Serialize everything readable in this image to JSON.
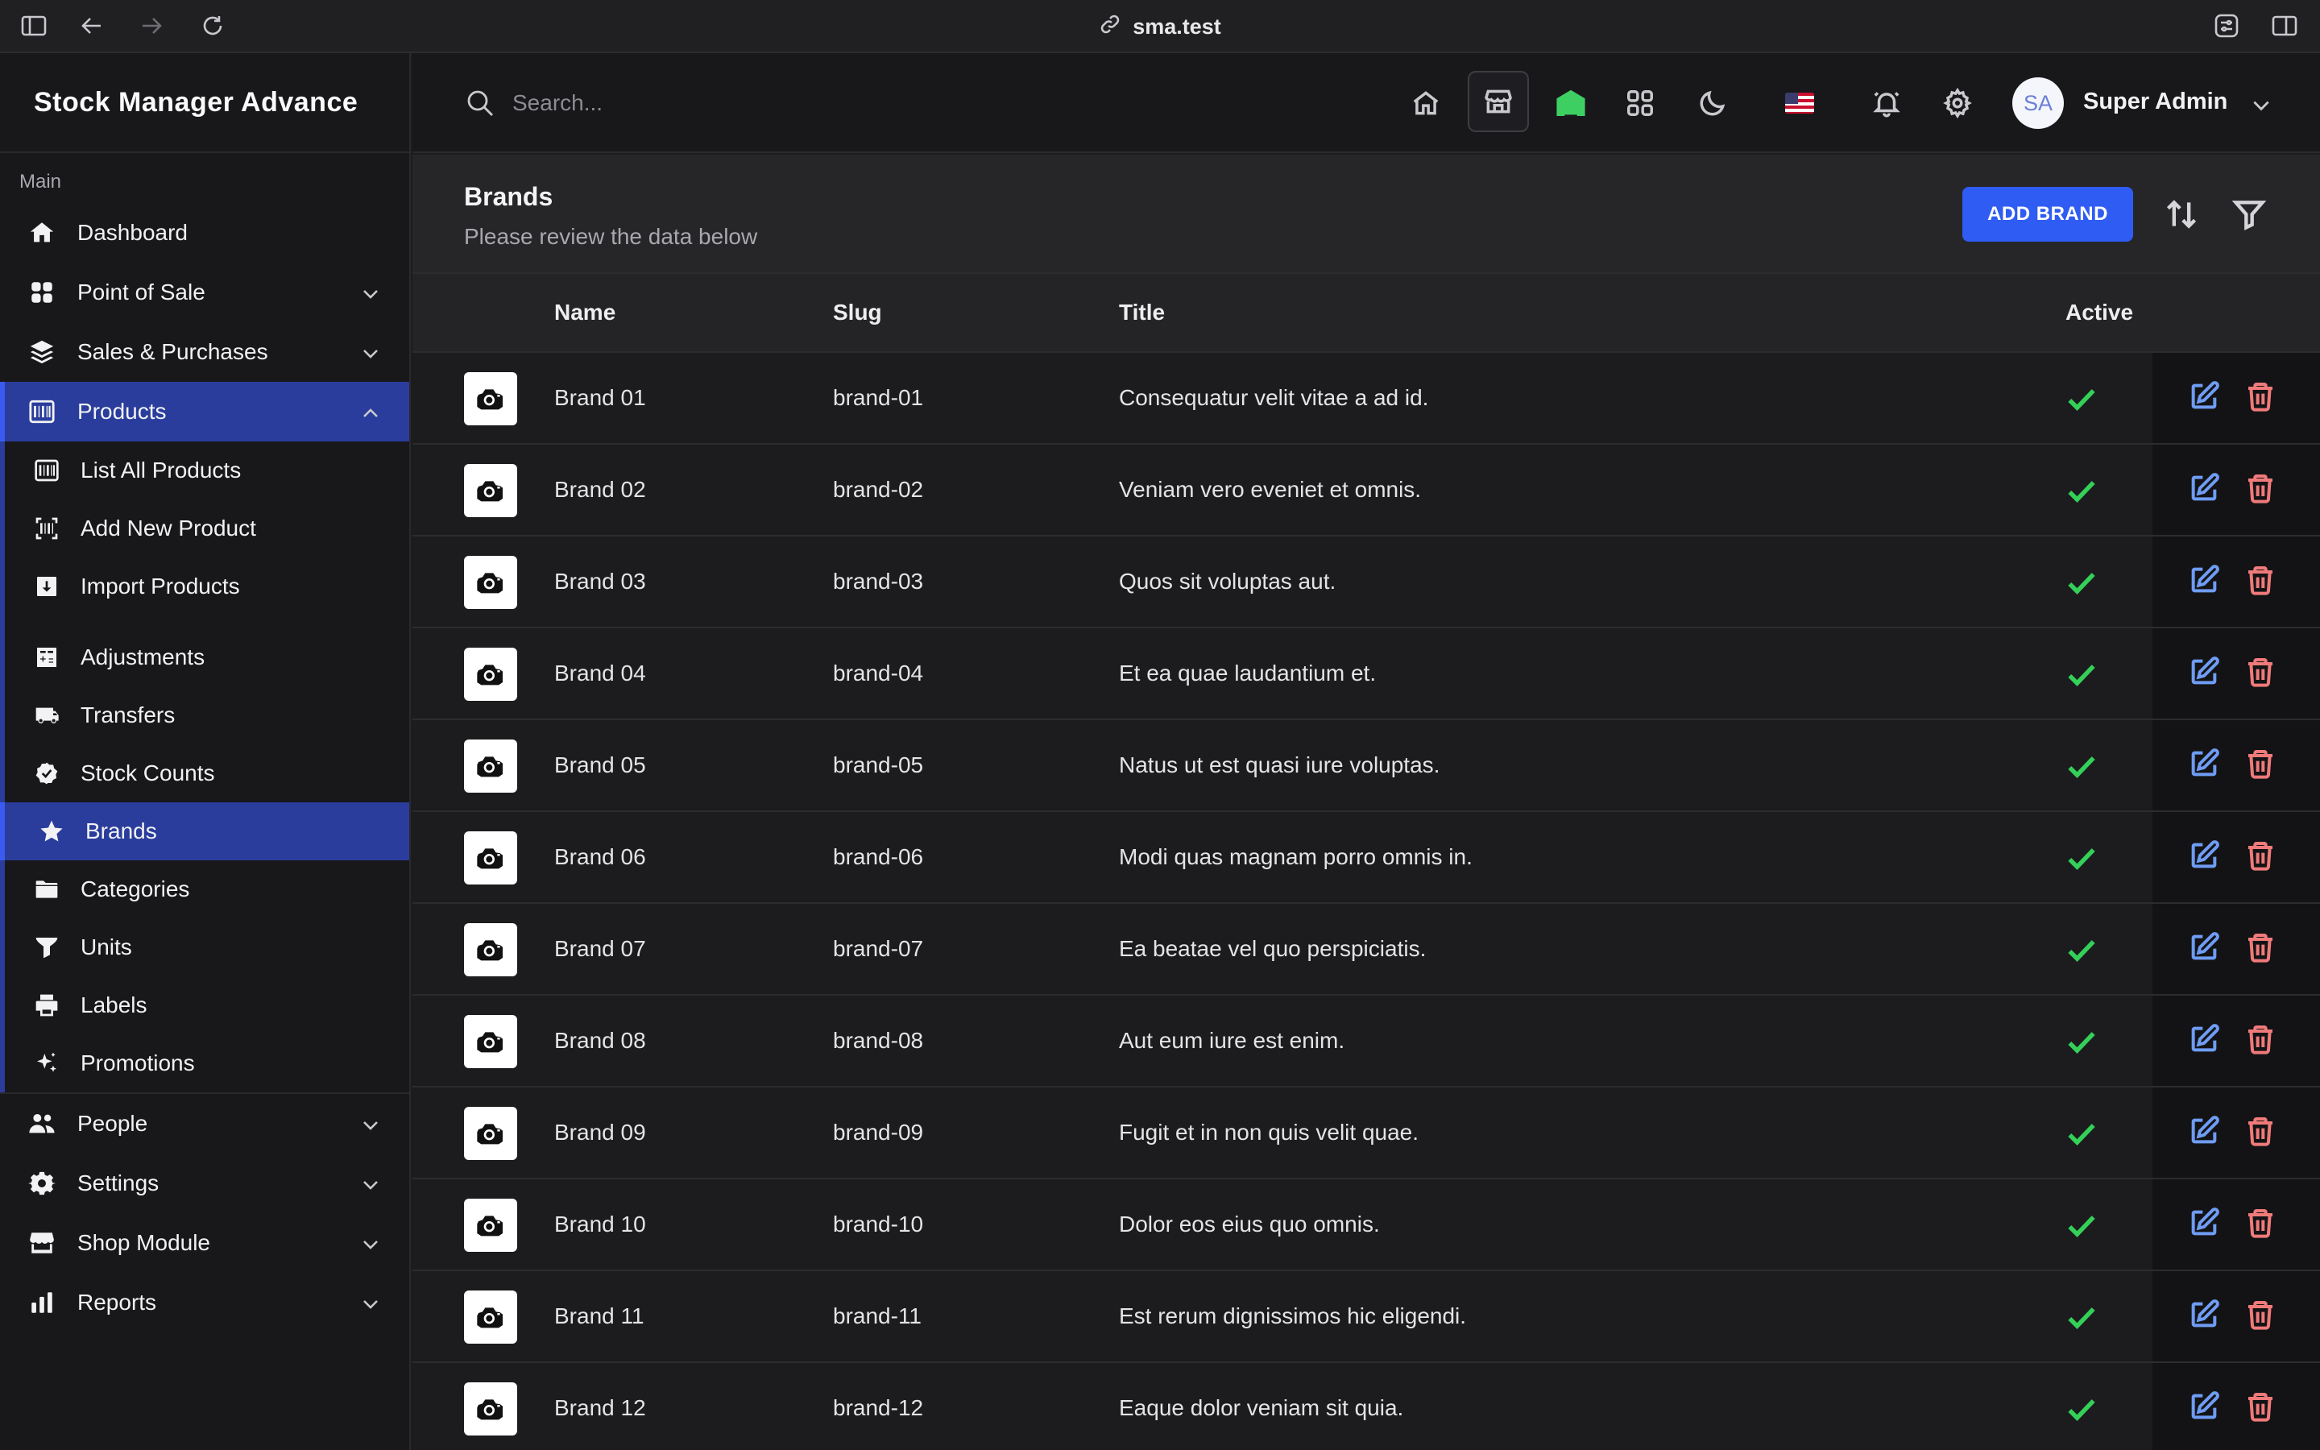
{
  "browser": {
    "url": "sma.test"
  },
  "app": {
    "title": "Stock Manager Advance"
  },
  "sidebar": {
    "section_label": "Main",
    "items": [
      {
        "label": "Dashboard",
        "icon": "home-icon"
      },
      {
        "label": "Point of Sale",
        "icon": "grid-icon"
      },
      {
        "label": "Sales & Purchases",
        "icon": "layers-icon"
      },
      {
        "label": "Products",
        "icon": "barcode-icon"
      },
      {
        "label": "People",
        "icon": "users-icon"
      },
      {
        "label": "Settings",
        "icon": "gear-icon"
      },
      {
        "label": "Shop Module",
        "icon": "store-icon"
      },
      {
        "label": "Reports",
        "icon": "bar-chart-icon"
      }
    ],
    "products_sub": [
      {
        "label": "List All Products",
        "icon": "barcode-icon"
      },
      {
        "label": "Add New Product",
        "icon": "barcode-scan-icon"
      },
      {
        "label": "Import Products",
        "icon": "import-icon"
      },
      {
        "label": "Adjustments",
        "icon": "calculator-icon"
      },
      {
        "label": "Transfers",
        "icon": "truck-icon"
      },
      {
        "label": "Stock Counts",
        "icon": "badge-check-icon"
      },
      {
        "label": "Brands",
        "icon": "star-icon"
      },
      {
        "label": "Categories",
        "icon": "folder-icon"
      },
      {
        "label": "Units",
        "icon": "funnel-icon"
      },
      {
        "label": "Labels",
        "icon": "printer-icon"
      },
      {
        "label": "Promotions",
        "icon": "sparkles-icon"
      }
    ]
  },
  "topbar": {
    "search_placeholder": "Search...",
    "user_initials": "SA",
    "user_name": "Super Admin"
  },
  "page": {
    "title": "Brands",
    "subtitle": "Please review the data below",
    "add_button": "ADD BRAND"
  },
  "table": {
    "columns": [
      "Name",
      "Slug",
      "Title",
      "Active"
    ],
    "rows": [
      {
        "name": "Brand 01",
        "slug": "brand-01",
        "title": "Consequatur velit vitae a ad id.",
        "active": true
      },
      {
        "name": "Brand 02",
        "slug": "brand-02",
        "title": "Veniam vero eveniet et omnis.",
        "active": true
      },
      {
        "name": "Brand 03",
        "slug": "brand-03",
        "title": "Quos sit voluptas aut.",
        "active": true
      },
      {
        "name": "Brand 04",
        "slug": "brand-04",
        "title": "Et ea quae laudantium et.",
        "active": true
      },
      {
        "name": "Brand 05",
        "slug": "brand-05",
        "title": "Natus ut est quasi iure voluptas.",
        "active": true
      },
      {
        "name": "Brand 06",
        "slug": "brand-06",
        "title": "Modi quas magnam porro omnis in.",
        "active": true
      },
      {
        "name": "Brand 07",
        "slug": "brand-07",
        "title": "Ea beatae vel quo perspiciatis.",
        "active": true
      },
      {
        "name": "Brand 08",
        "slug": "brand-08",
        "title": "Aut eum iure est enim.",
        "active": true
      },
      {
        "name": "Brand 09",
        "slug": "brand-09",
        "title": "Fugit et in non quis velit quae.",
        "active": true
      },
      {
        "name": "Brand 10",
        "slug": "brand-10",
        "title": "Dolor eos eius quo omnis.",
        "active": true
      },
      {
        "name": "Brand 11",
        "slug": "brand-11",
        "title": "Est rerum dignissimos hic eligendi.",
        "active": true
      },
      {
        "name": "Brand 12",
        "slug": "brand-12",
        "title": "Eaque dolor veniam sit quia.",
        "active": true
      }
    ]
  },
  "colors": {
    "accent": "#2f5cf2",
    "active_nav": "#2a3d9c",
    "check": "#34d058",
    "edit": "#6f9cf4",
    "delete": "#f07a7a"
  }
}
